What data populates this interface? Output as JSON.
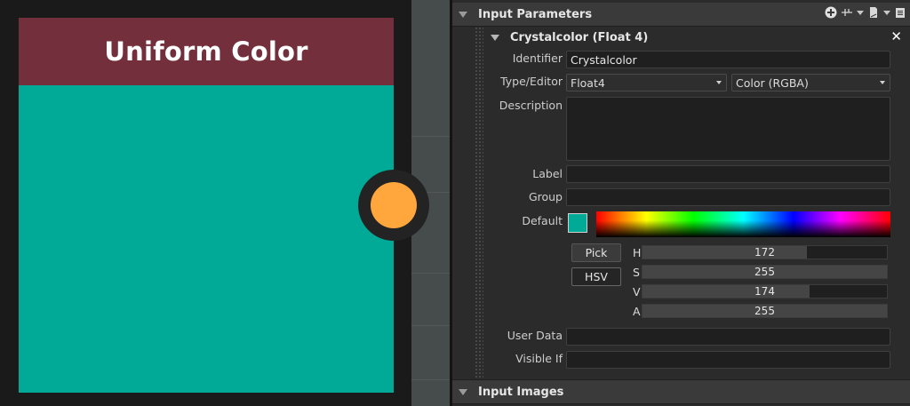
{
  "node": {
    "title": "Uniform Color",
    "header_color": "#732f3b",
    "swatch_color": "#00aa96",
    "output_color": "#ffa63c"
  },
  "panel": {
    "section_title": "Input Parameters",
    "header_icons": [
      "add-icon",
      "dropdown-caret",
      "connect-icon",
      "dropdown-caret",
      "page-icon",
      "dropdown-caret",
      "document-icon"
    ],
    "parameter": {
      "title": "Crystalcolor (Float 4)",
      "close_label": "✕",
      "identifier_label": "Identifier",
      "identifier_value": "Crystalcolor",
      "type_label": "Type/Editor",
      "type_value": "Float4",
      "editor_value": "Color (RGBA)",
      "description_label": "Description",
      "description_value": "",
      "label_label": "Label",
      "label_value": "",
      "group_label": "Group",
      "group_value": "",
      "default_label": "Default",
      "default_color": "#00aa96",
      "pick_label": "Pick",
      "hsv_label": "HSV",
      "sliders": [
        {
          "name": "H",
          "value": "172",
          "max": 255
        },
        {
          "name": "S",
          "value": "255",
          "max": 255
        },
        {
          "name": "V",
          "value": "174",
          "max": 255
        },
        {
          "name": "A",
          "value": "255",
          "max": 255
        }
      ],
      "user_data_label": "User Data",
      "user_data_value": "",
      "visible_if_label": "Visible If",
      "visible_if_value": ""
    },
    "images_section_title": "Input Images"
  }
}
